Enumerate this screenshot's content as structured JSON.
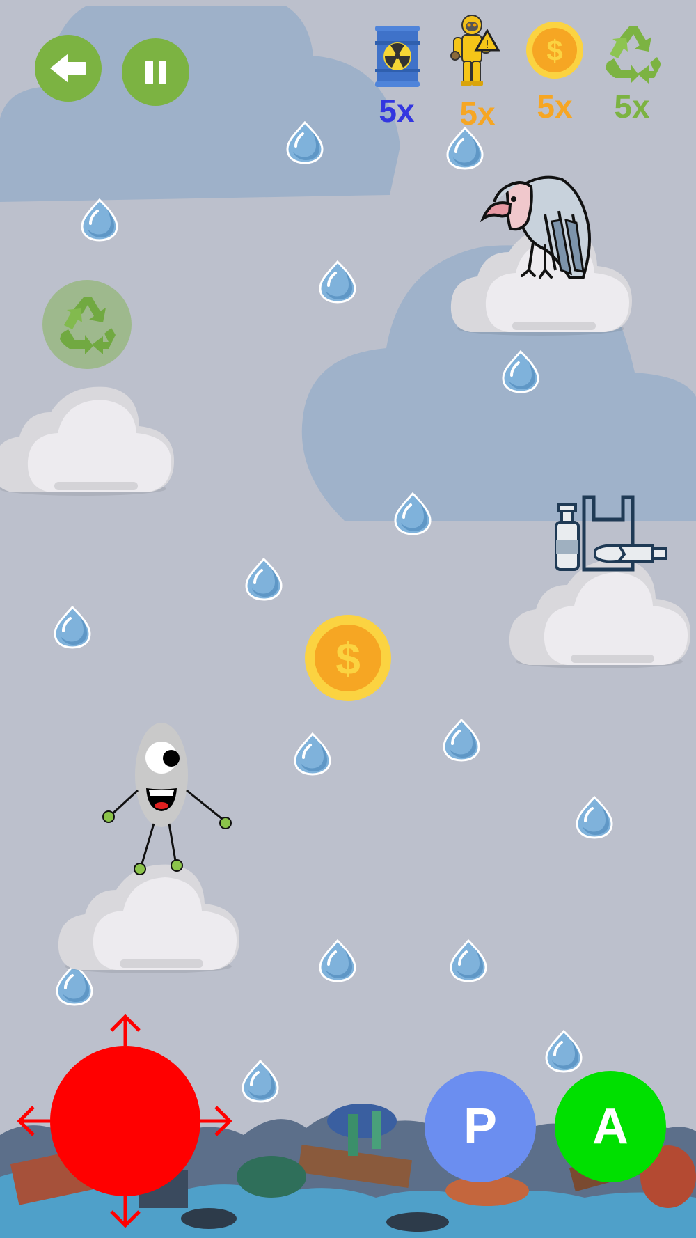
{
  "hud": {
    "barrel": {
      "icon": "radioactive-barrel-icon",
      "count": "5x",
      "color": "#3336e0"
    },
    "hazmat": {
      "icon": "hazmat-suit-icon",
      "count": "5x",
      "color": "#f6a623"
    },
    "coin": {
      "icon": "dollar-coin-icon",
      "count": "5x",
      "color": "#f6a623"
    },
    "recycle": {
      "icon": "recycle-icon",
      "count": "5x",
      "color": "#7cb342"
    }
  },
  "controls": {
    "back": {
      "icon": "back-arrow-icon"
    },
    "pause": {
      "icon": "pause-icon"
    },
    "joystick": {
      "icon": "joystick-icon",
      "color": "#ff0000"
    },
    "p_button": {
      "label": "P",
      "color": "#6b8ef0"
    },
    "a_button": {
      "label": "A",
      "color": "#00e000"
    }
  },
  "scene": {
    "sky_color": "#bcc0cc",
    "cloud_color": "#eceaee",
    "bg_cloud_color": "#9fb2ca",
    "accent_green": "#7cb342"
  }
}
